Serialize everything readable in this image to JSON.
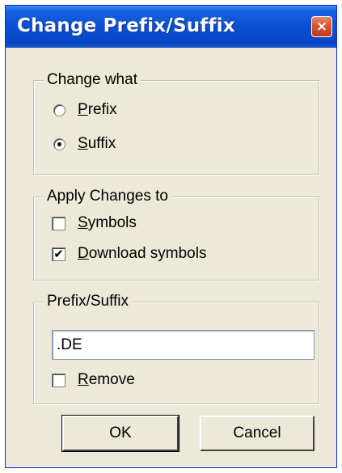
{
  "window": {
    "title": "Change Prefix/Suffix",
    "close_glyph": "×"
  },
  "change_what": {
    "legend": "Change what",
    "options": [
      {
        "label": "Prefix",
        "mnemonic": "P",
        "rest": "refix",
        "selected": false
      },
      {
        "label": "Suffix",
        "mnemonic": "S",
        "rest": "uffix",
        "selected": true
      }
    ]
  },
  "apply_changes": {
    "legend": "Apply Changes to",
    "options": [
      {
        "label": "Symbols",
        "mnemonic": "S",
        "rest": "ymbols",
        "checked": false
      },
      {
        "label": "Download symbols",
        "mnemonic": "D",
        "rest": "ownload symbols",
        "checked": true
      }
    ]
  },
  "prefix_suffix": {
    "legend": "Prefix/Suffix",
    "value": ".DE",
    "remove": {
      "label": "Remove",
      "mnemonic": "R",
      "rest": "emove",
      "checked": false
    }
  },
  "buttons": {
    "ok_label": "OK",
    "cancel_label": "Cancel"
  },
  "colors": {
    "titlebar": "#0a4fd3",
    "dialog_bg": "#ece9d8",
    "close_button": "#d8532f"
  },
  "icons": {
    "close": "close-icon",
    "check": "checkmark-icon"
  }
}
